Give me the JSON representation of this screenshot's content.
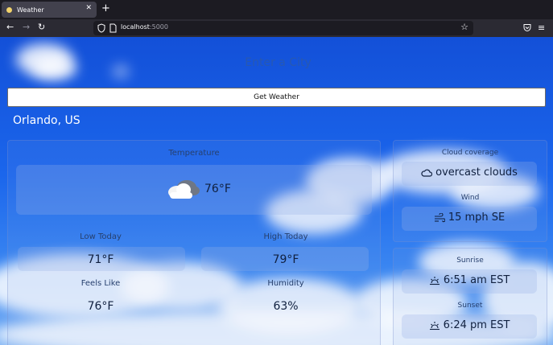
{
  "browser": {
    "tab_title": "Weather",
    "url_host": "localhost",
    "url_port": ":5000"
  },
  "search": {
    "placeholder": "Enter a City",
    "button_label": "Get Weather"
  },
  "location": "Orlando, US",
  "temperature": {
    "label": "Temperature",
    "value": "76°F",
    "icon": "cloud-icon"
  },
  "low_today": {
    "label": "Low Today",
    "value": "71°F"
  },
  "high_today": {
    "label": "High Today",
    "value": "79°F"
  },
  "feels_like": {
    "label": "Feels Like",
    "value": "76°F"
  },
  "humidity": {
    "label": "Humidity",
    "value": "63%"
  },
  "cloud_coverage": {
    "label": "Cloud coverage",
    "value": "overcast clouds",
    "icon": "cloud-outline-icon"
  },
  "wind": {
    "label": "Wind",
    "value": "15 mph SE",
    "icon": "wind-icon"
  },
  "sunrise": {
    "label": "Sunrise",
    "value": "6:51 am EST",
    "icon": "sunrise-icon"
  },
  "sunset": {
    "label": "Sunset",
    "value": "6:24 pm EST",
    "icon": "sunset-icon"
  }
}
